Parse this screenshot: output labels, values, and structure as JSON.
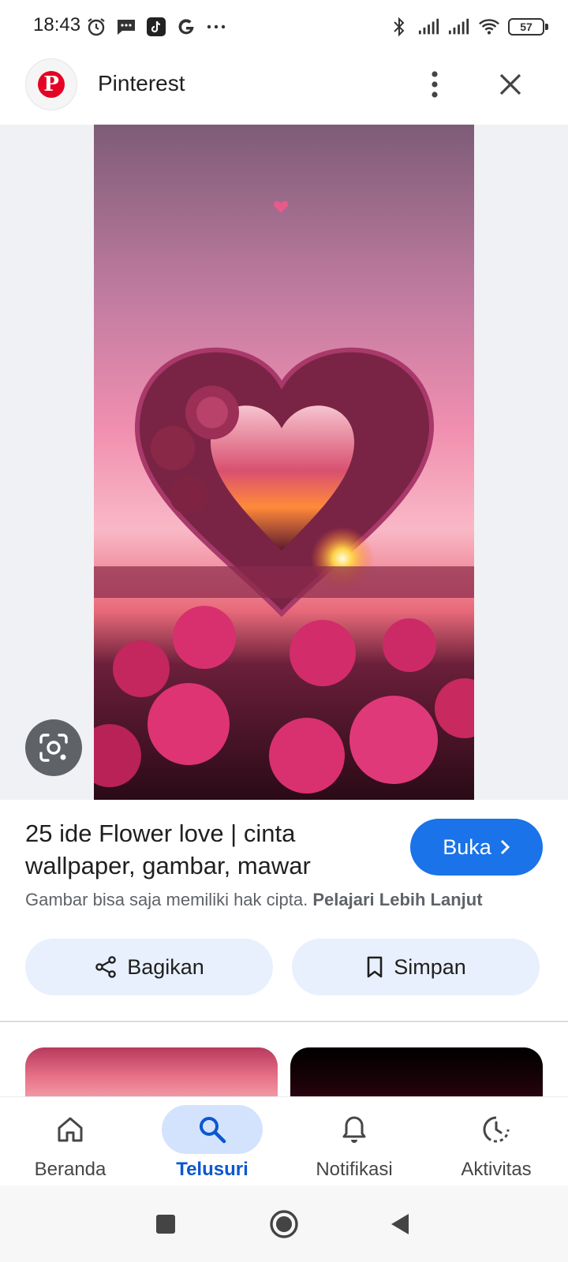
{
  "status_bar": {
    "time": "18:43",
    "battery": "57",
    "left_icons": [
      "alarm-icon",
      "message-icon",
      "tiktok-icon",
      "google-icon",
      "more-dots-icon"
    ],
    "right_icons": [
      "bluetooth-icon",
      "signal-icon",
      "signal-icon",
      "wifi-icon",
      "battery-icon"
    ]
  },
  "header": {
    "source_name": "Pinterest",
    "logo_letter": "P",
    "more_icon": "more-vert-icon",
    "close_icon": "close-icon"
  },
  "result": {
    "title": "25 ide Flower love | cinta wallpaper, gambar, mawar",
    "open_button": "Buka",
    "copyright_text": "Gambar bisa saja memiliki hak cipta.",
    "learn_more": "Pelajari Lebih Lanjut",
    "share_button": "Bagikan",
    "save_button": "Simpan"
  },
  "bottom_nav": {
    "items": [
      {
        "label": "Beranda",
        "icon": "home-icon",
        "active": false
      },
      {
        "label": "Telusuri",
        "icon": "search-icon",
        "active": true
      },
      {
        "label": "Notifikasi",
        "icon": "bell-icon",
        "active": false
      },
      {
        "label": "Aktivitas",
        "icon": "history-icon",
        "active": false
      }
    ]
  },
  "colors": {
    "accent": "#1a73e8",
    "active_nav": "#0b57d0",
    "pinterest_red": "#e60023"
  }
}
